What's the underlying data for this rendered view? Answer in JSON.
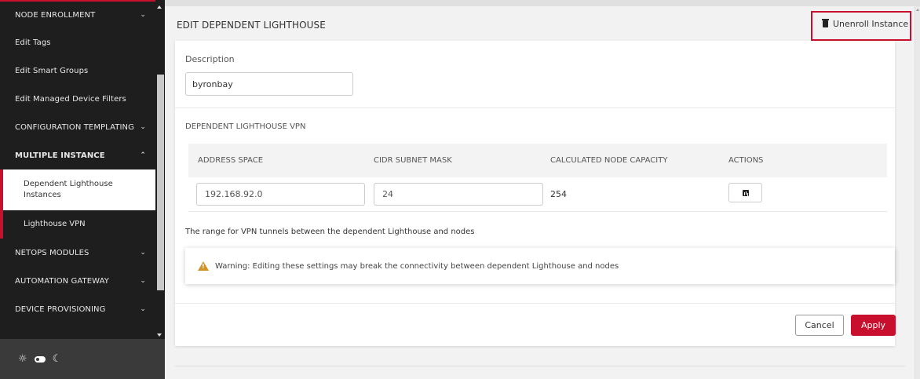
{
  "sidebar": {
    "items": [
      {
        "label": "NODE ENROLLMENT",
        "chevron": "chevron-down"
      },
      {
        "label": "Edit Tags"
      },
      {
        "label": "Edit Smart Groups"
      },
      {
        "label": "Edit Managed Device Filters"
      },
      {
        "label": "CONFIGURATION TEMPLATING",
        "chevron": "chevron-down"
      },
      {
        "label": "MULTIPLE INSTANCE",
        "chevron": "chevron-up"
      },
      {
        "label": "Dependent Lighthouse Instances"
      },
      {
        "label": "Lighthouse VPN"
      },
      {
        "label": "NETOPS MODULES",
        "chevron": "chevron-down"
      },
      {
        "label": "AUTOMATION GATEWAY",
        "chevron": "chevron-down"
      },
      {
        "label": "DEVICE PROVISIONING",
        "chevron": "chevron-down"
      }
    ],
    "theme_icons": [
      "sun-icon",
      "toggle-icon",
      "moon-icon"
    ]
  },
  "header": {
    "title": "EDIT DEPENDENT LIGHTHOUSE",
    "unenroll_label": "Unenroll Instance"
  },
  "form": {
    "description_label": "Description",
    "description_value": "byronbay",
    "vpn_heading": "DEPENDENT LIGHTHOUSE VPN",
    "columns": [
      "ADDRESS SPACE",
      "CIDR SUBNET MASK",
      "CALCULATED NODE CAPACITY",
      "ACTIONS"
    ],
    "row": {
      "address_space": "192.168.92.0",
      "cidr_mask": "24",
      "capacity": "254"
    },
    "range_text": "The range for VPN tunnels between the dependent Lighthouse and nodes",
    "warning_text": "Warning:  Editing these settings may break the connectivity between dependent Lighthouse and nodes"
  },
  "footer": {
    "cancel_label": "Cancel",
    "apply_label": "Apply"
  },
  "colors": {
    "accent": "#c8102e",
    "sidebar_bg": "#1e1e1e",
    "warning": "#d19326"
  }
}
